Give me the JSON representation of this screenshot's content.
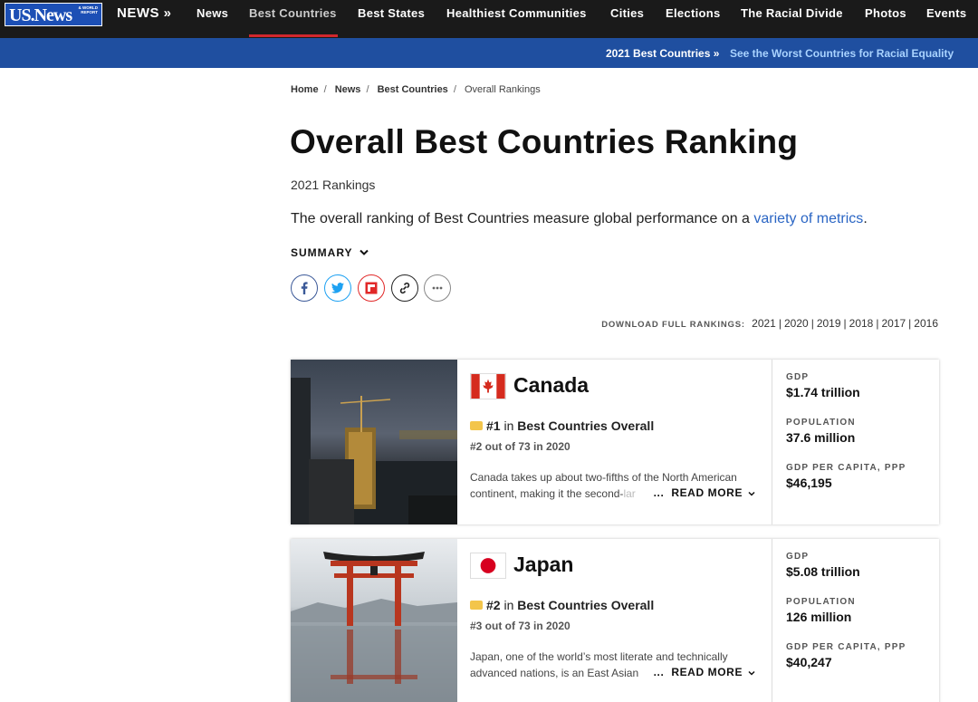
{
  "nav": {
    "logo_text": "US.News",
    "logo_sub": "& WORLD REPORT",
    "news_head": "NEWS »",
    "items": [
      "News",
      "Best Countries",
      "Best States",
      "Healthiest Communities",
      "Cities",
      "Elections",
      "The Racial Divide",
      "Photos",
      "Events"
    ]
  },
  "subbar": {
    "left": "2021 Best Countries »",
    "right": "See the Worst Countries for Racial Equality"
  },
  "breadcrumb": [
    "Home",
    "News",
    "Best Countries",
    "Overall Rankings"
  ],
  "page": {
    "title": "Overall Best Countries Ranking",
    "subtitle": "2021 Rankings",
    "lede_before": "The overall ranking of Best Countries measure global performance on a ",
    "lede_link": "variety of metrics",
    "lede_after": ".",
    "summary_label": "SUMMARY"
  },
  "share_icons": [
    "facebook-icon",
    "twitter-icon",
    "flipboard-icon",
    "link-icon",
    "more-icon"
  ],
  "downloads": {
    "label": "DOWNLOAD FULL RANKINGS:",
    "years": [
      "2021",
      "2020",
      "2019",
      "2018",
      "2017",
      "2016"
    ]
  },
  "cards": [
    {
      "country": "Canada",
      "rank": "#1",
      "rank_in": "in",
      "rank_category": "Best Countries Overall",
      "prev_rank": "#2 out of 73 in 2020",
      "blurb_visible": "Canada takes up about two-fifths of the North American continent, making it the second-",
      "blurb_faded": "lar",
      "ellipsis": "...",
      "read_more": "READ MORE",
      "stats": [
        {
          "label": "GDP",
          "value": "$1.74 trillion"
        },
        {
          "label": "POPULATION",
          "value": "37.6 million"
        },
        {
          "label": "GDP PER CAPITA, PPP",
          "value": "$46,195"
        }
      ]
    },
    {
      "country": "Japan",
      "rank": "#2",
      "rank_in": "in",
      "rank_category": "Best Countries Overall",
      "prev_rank": "#3 out of 73 in 2020",
      "blurb_visible": "Japan, one of the world’s most literate and technically advanced nations, is an East Asian",
      "blurb_faded": "",
      "ellipsis": "...",
      "read_more": "READ MORE",
      "stats": [
        {
          "label": "GDP",
          "value": "$5.08 trillion"
        },
        {
          "label": "POPULATION",
          "value": "126 million"
        },
        {
          "label": "GDP PER CAPITA, PPP",
          "value": "$40,247"
        }
      ]
    }
  ],
  "colors": {
    "nav_bg": "#1a1a1a",
    "subbar_bg": "#1f4fa0",
    "accent_red": "#d0272d",
    "link_blue": "#2a65c4",
    "medal": "#f3c54b"
  }
}
